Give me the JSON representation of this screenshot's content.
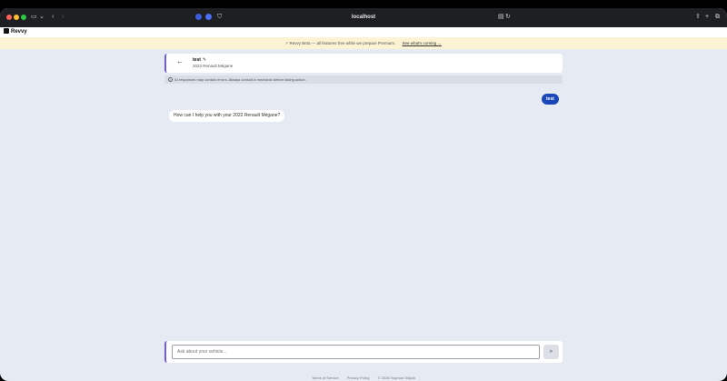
{
  "browser": {
    "url": "localhost"
  },
  "app": {
    "brand": "Revvy"
  },
  "banner": {
    "text": "⚡ Revvy Beta — all features free while we prepare Premium.",
    "link": "See what's coming →"
  },
  "chat": {
    "title": "test",
    "vehicle": "2022 Renault Mégane",
    "back_icon": "arrow-left-icon",
    "edit_icon": "pencil-icon"
  },
  "disclaimer": {
    "text": "AI responses may contain errors. Always consult a mechanic before taking action."
  },
  "messages": [
    {
      "role": "user",
      "text": "test"
    },
    {
      "role": "assistant",
      "text": "How can I help you with your 2022 Renault Mégane?"
    }
  ],
  "composer": {
    "placeholder": "Ask about your vehicle...",
    "send_icon": "send-icon"
  },
  "footer": {
    "terms": "Terms of Service",
    "privacy": "Privacy Policy",
    "copyright": "© 2026 Szymon Wójcik"
  },
  "colors": {
    "accent": "#6c5ce7",
    "user_bubble": "#1a46b8",
    "banner_bg": "#fbf3d3",
    "page_bg": "#e6eaf2"
  }
}
